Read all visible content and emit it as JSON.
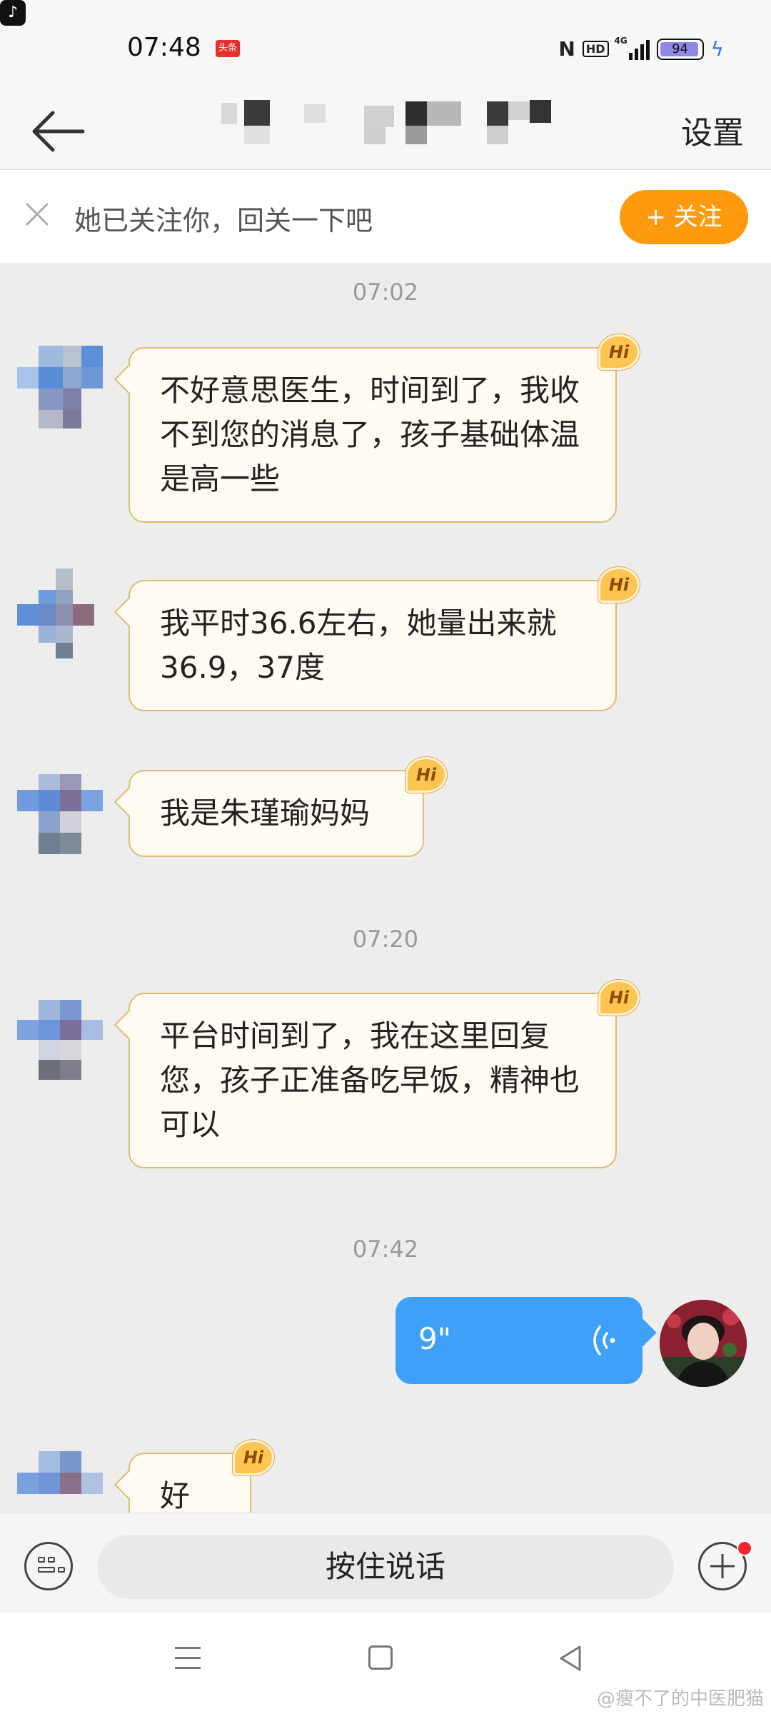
{
  "status_bar": {
    "time": "07:48",
    "toutiao_badge": "头条",
    "tiktok_icon": "♪",
    "nfc_label": "N",
    "hd_label": "HD",
    "network_label": "4G",
    "battery_level": "94",
    "battery_fraction": 0.94,
    "charging_icon": "ϟ"
  },
  "header": {
    "settings_label": "设置"
  },
  "follow_bar": {
    "text": "她已关注你，回关一下吧",
    "button_label": "+ 关注"
  },
  "chat": {
    "timestamps": [
      "07:02",
      "07:20",
      "07:42"
    ],
    "messages": [
      {
        "sender": "other",
        "text": "不好意思医生，时间到了，我收不到您的消息了，孩子基础体温是高一些",
        "badge": "Hi"
      },
      {
        "sender": "other",
        "text": "我平时36.6左右，她量出来就36.9，37度",
        "badge": "Hi"
      },
      {
        "sender": "other",
        "text": "我是朱瑾瑜妈妈",
        "badge": "Hi"
      },
      {
        "sender": "other",
        "text": "平台时间到了，我在这里回复您，孩子正准备吃早饭，精神也可以",
        "badge": "Hi"
      },
      {
        "sender": "me",
        "type": "voice",
        "duration": "9\""
      },
      {
        "sender": "other",
        "text": "好的",
        "badge": "Hi"
      }
    ]
  },
  "input_bar": {
    "hold_to_talk_label": "按住说话"
  },
  "watermark": "@瘦不了的中医肥猫",
  "colors": {
    "accent_orange": "#ff9a0f",
    "bubble_border": "#e2b976",
    "voice_blue": "#3ea0f7",
    "background": "#ededed"
  }
}
